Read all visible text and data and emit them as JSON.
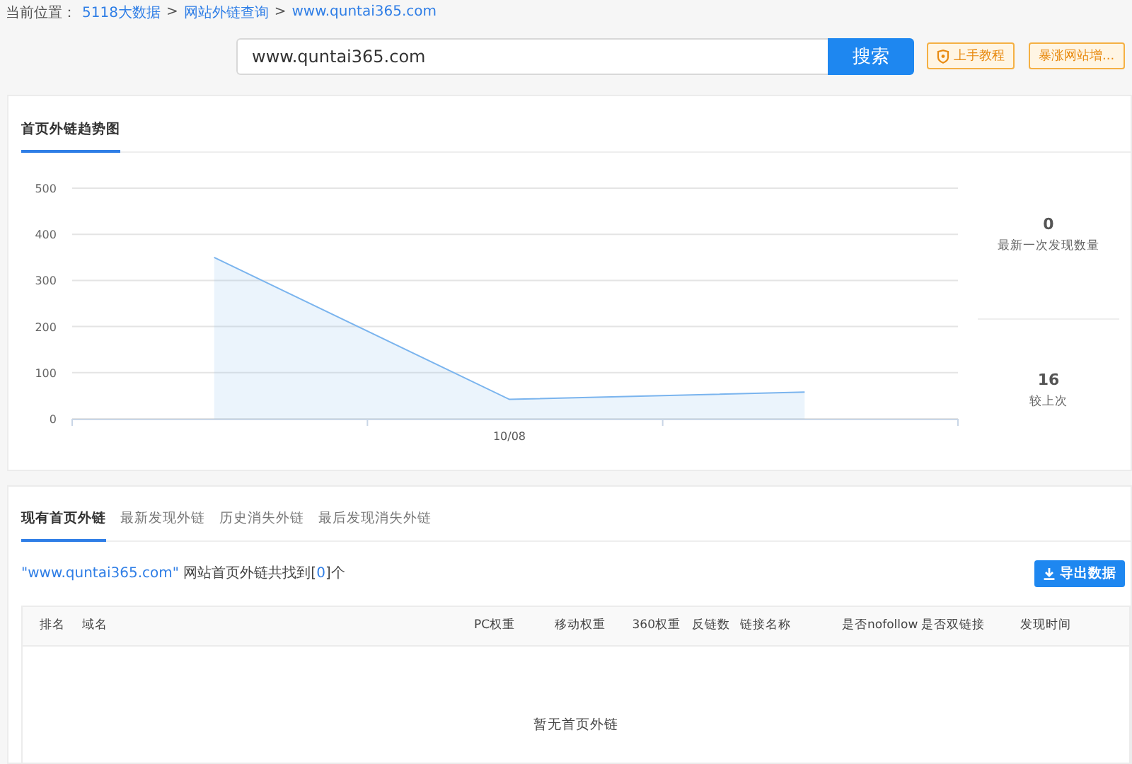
{
  "breadcrumb": {
    "label": "当前位置：",
    "links": [
      "5118大数据",
      "网站外链查询",
      "www.quntai365.com"
    ],
    "separator": ">"
  },
  "search": {
    "value": "www.quntai365.com",
    "button": "搜索"
  },
  "actions": [
    {
      "label": "上手教程",
      "kind": "tutorial"
    },
    {
      "label": "暴涨网站增...",
      "kind": "plain"
    }
  ],
  "trend": {
    "tabs": [
      {
        "label": "首页外链趋势图",
        "selected": true
      }
    ],
    "chart_data": {
      "type": "area",
      "series": [
        {
          "color": "#7ab4ee",
          "values": [
            350,
            42,
            58
          ]
        }
      ],
      "ylim": [
        0,
        500
      ],
      "grid": true,
      "yticks": [
        0,
        100,
        200,
        300,
        400,
        500
      ]
    },
    "axis_date": "10/08",
    "stats": [
      {
        "value": "0",
        "label": "最新一次发现数量"
      },
      {
        "value": "16",
        "label": "较上次"
      }
    ]
  },
  "links": {
    "tabs": [
      {
        "label": "现有首页外链",
        "selected": true
      },
      {
        "label": "最新发现外链",
        "selected": false
      },
      {
        "label": "历史消失外链",
        "selected": false
      },
      {
        "label": "最后发现消失外链",
        "selected": false
      }
    ],
    "summary": {
      "query": "\"www.quntai365.com\"",
      "before": " 网站首页外链共找到[",
      "count": "0",
      "after": "]个"
    },
    "export": "导出数据",
    "table": {
      "columns": [
        "排名",
        "域名",
        "PC权重",
        "移动权重",
        "360权重",
        "反链数",
        "链接名称",
        "是否nofollow",
        "是否双链接",
        "发现时间"
      ],
      "empty": "暂无首页外链"
    }
  }
}
